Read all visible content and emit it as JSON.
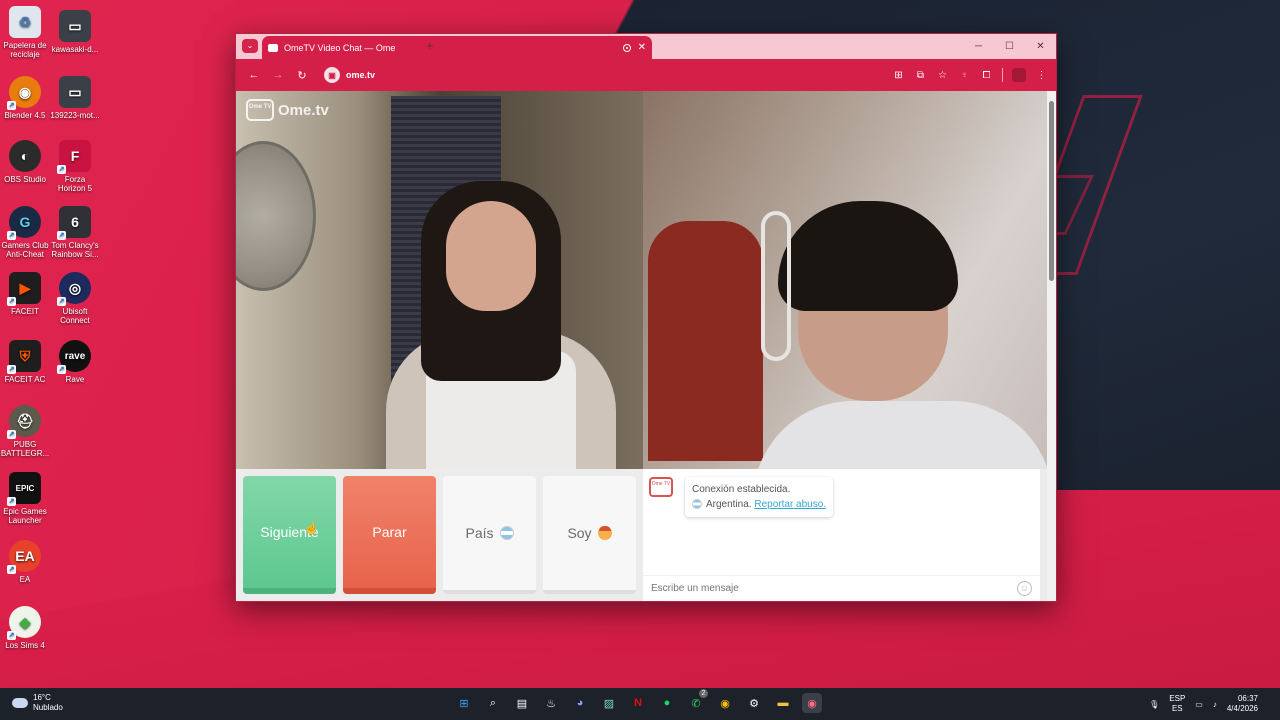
{
  "desktop": {
    "icons": [
      {
        "label": "Papelera de reciclaje",
        "icon": "recycle-bin-icon"
      },
      {
        "label": "kawasaki-d...",
        "icon": "image-file-icon"
      },
      {
        "label": "Blender 4.5",
        "icon": "blender-icon"
      },
      {
        "label": "139223-mot...",
        "icon": "image-file-icon"
      },
      {
        "label": "OBS Studio",
        "icon": "obs-icon"
      },
      {
        "label": "Forza Horizon 5",
        "icon": "forza-icon"
      },
      {
        "label": "Gamers Club Anti-Cheat",
        "icon": "gamersclub-icon"
      },
      {
        "label": "Tom Clancy's Rainbow Si...",
        "icon": "rainbow-six-icon"
      },
      {
        "label": "FACEIT",
        "icon": "faceit-icon"
      },
      {
        "label": "Ubisoft Connect",
        "icon": "ubisoft-icon"
      },
      {
        "label": "FACEIT AC",
        "icon": "faceit-ac-icon"
      },
      {
        "label": "Rave",
        "icon": "rave-icon"
      },
      {
        "label": "PUBG BATTLEGR...",
        "icon": "pubg-icon"
      },
      {
        "label": "Epic Games Launcher",
        "icon": "epic-games-icon"
      },
      {
        "label": "EA",
        "icon": "ea-icon"
      },
      {
        "label": "Los Sims 4",
        "icon": "sims-icon"
      }
    ]
  },
  "browser": {
    "tab_title": "OmeTV Video Chat — Ome",
    "url": "ome.tv",
    "new_tab": "+",
    "tab_close": "✕"
  },
  "site": {
    "logo_text": "Ome.tv",
    "logo_badge": "Ome TV",
    "buttons": {
      "next": "Siguiente",
      "stop": "Parar",
      "country": "País",
      "soy": "Soy"
    },
    "chat": {
      "status": "Conexión establecida.",
      "country": "Argentina.",
      "report_link": "Reportar abuso.",
      "input_placeholder": "Escribe un mensaje"
    }
  },
  "taskbar": {
    "temperature": "16°C",
    "weather": "Nublado",
    "lang_top": "ESP",
    "lang_bottom": "ES",
    "time": "06:37",
    "date": "4/4/2026",
    "whatsapp_badge": "2"
  },
  "colors": {
    "brand": "#d41f48",
    "next_button": "#5dc891",
    "stop_button": "#e8634b",
    "link": "#35a8cf"
  }
}
